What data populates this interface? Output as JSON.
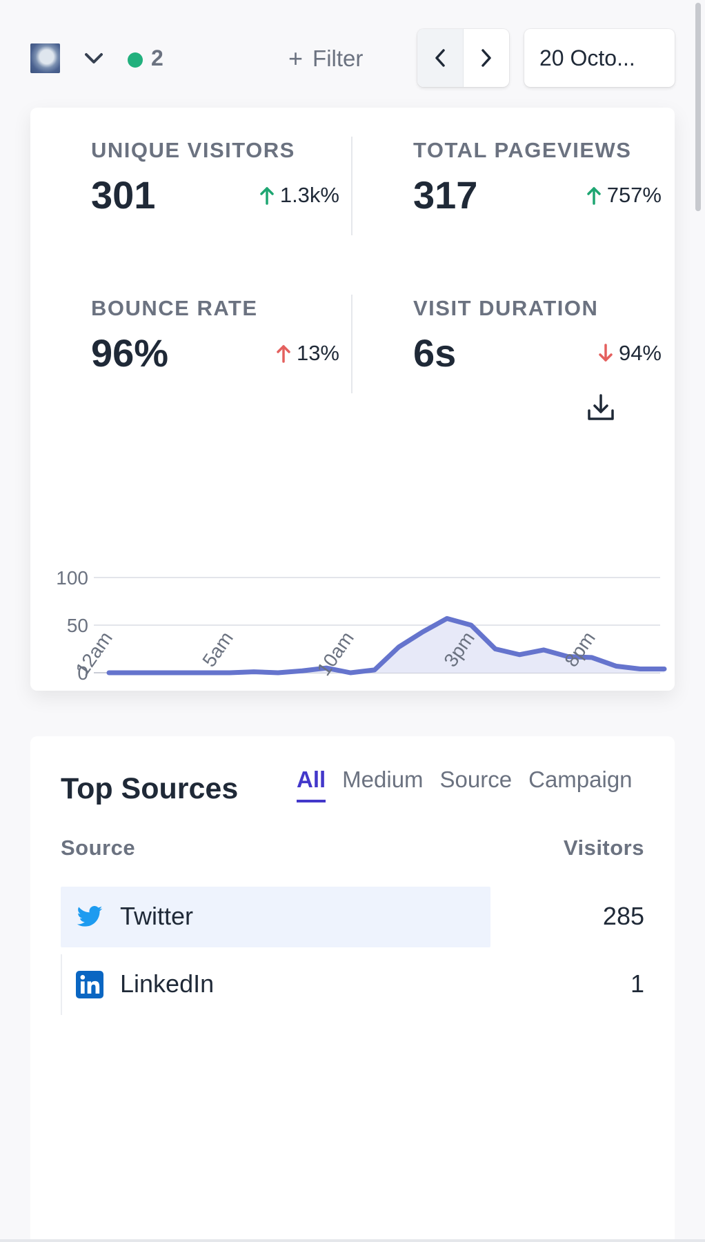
{
  "header": {
    "site_icon": "site-thumbnail",
    "live_visitors": "2",
    "filter_label": "Filter",
    "date_label": "20 Octo..."
  },
  "stats": [
    {
      "label": "UNIQUE VISITORS",
      "value": "301",
      "change": "1.3k%",
      "direction": "up",
      "trend_color": "#1ea672"
    },
    {
      "label": "TOTAL PAGEVIEWS",
      "value": "317",
      "change": "757%",
      "direction": "up",
      "trend_color": "#1ea672"
    },
    {
      "label": "BOUNCE RATE",
      "value": "96%",
      "change": "13%",
      "direction": "up",
      "trend_color": "#e4605e"
    },
    {
      "label": "VISIT DURATION",
      "value": "6s",
      "change": "94%",
      "direction": "down",
      "trend_color": "#e4605e"
    }
  ],
  "chart_data": {
    "type": "area",
    "x_tick_labels": [
      "12am",
      "5am",
      "10am",
      "3pm",
      "8pm"
    ],
    "x": [
      "12am",
      "1am",
      "2am",
      "3am",
      "4am",
      "5am",
      "6am",
      "7am",
      "8am",
      "9am",
      "10am",
      "11am",
      "12pm",
      "1pm",
      "2pm",
      "3pm",
      "4pm",
      "5pm",
      "6pm",
      "7pm",
      "8pm",
      "9pm",
      "10pm",
      "11pm"
    ],
    "series": [
      {
        "values": [
          0,
          0,
          0,
          0,
          0,
          0,
          1,
          0,
          2,
          5,
          0,
          3,
          27,
          43,
          57,
          50,
          25,
          19,
          24,
          17,
          16,
          7,
          4,
          4
        ]
      }
    ],
    "y_ticks": [
      "0",
      "50",
      "100"
    ],
    "ylim": [
      0,
      100
    ],
    "grid": true,
    "line_color": "#6574cd",
    "fill_color": "#e7e9f8"
  },
  "sources": {
    "title": "Top Sources",
    "tabs": [
      "All",
      "Medium",
      "Source",
      "Campaign"
    ],
    "active_tab": "All",
    "col_source": "Source",
    "col_visitors": "Visitors",
    "rows": [
      {
        "name": "Twitter",
        "visitors": "285",
        "icon": "twitter-icon",
        "share": 0.736
      },
      {
        "name": "LinkedIn",
        "visitors": "1",
        "icon": "linkedin-icon",
        "share": 0.0
      }
    ]
  }
}
